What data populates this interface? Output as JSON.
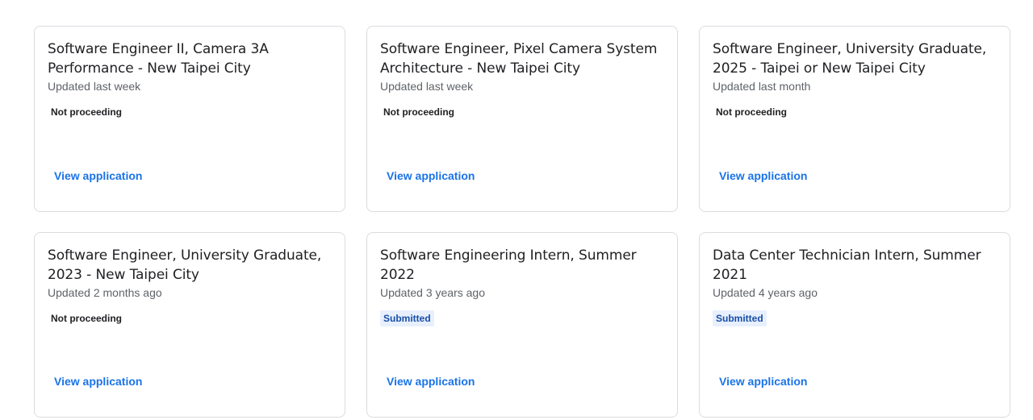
{
  "applications": [
    {
      "title": "Software Engineer II, Camera 3A Performance - New Taipei City",
      "updated": "Updated last week",
      "status": "Not proceeding",
      "link": "View application"
    },
    {
      "title": "Software Engineer, Pixel Camera System Architecture - New Taipei City",
      "updated": "Updated last week",
      "status": "Not proceeding",
      "link": "View application"
    },
    {
      "title": "Software Engineer, University Graduate, 2025 - Taipei or New Taipei City",
      "updated": "Updated last month",
      "status": "Not proceeding",
      "link": "View application"
    },
    {
      "title": "Software Engineer, University Graduate, 2023 - New Taipei City",
      "updated": "Updated 2 months ago",
      "status": "Not proceeding",
      "link": "View application"
    },
    {
      "title": "Software Engineering Intern, Summer 2022",
      "updated": "Updated 3 years ago",
      "status": "Submitted",
      "link": "View application"
    },
    {
      "title": "Data Center Technician Intern, Summer 2021",
      "updated": "Updated 4 years ago",
      "status": "Submitted",
      "link": "View application"
    }
  ],
  "colors": {
    "link": "#1a73e8",
    "submitted_text": "#174ea6",
    "submitted_bg": "#e8f0fe",
    "card_border": "#dadce0"
  }
}
